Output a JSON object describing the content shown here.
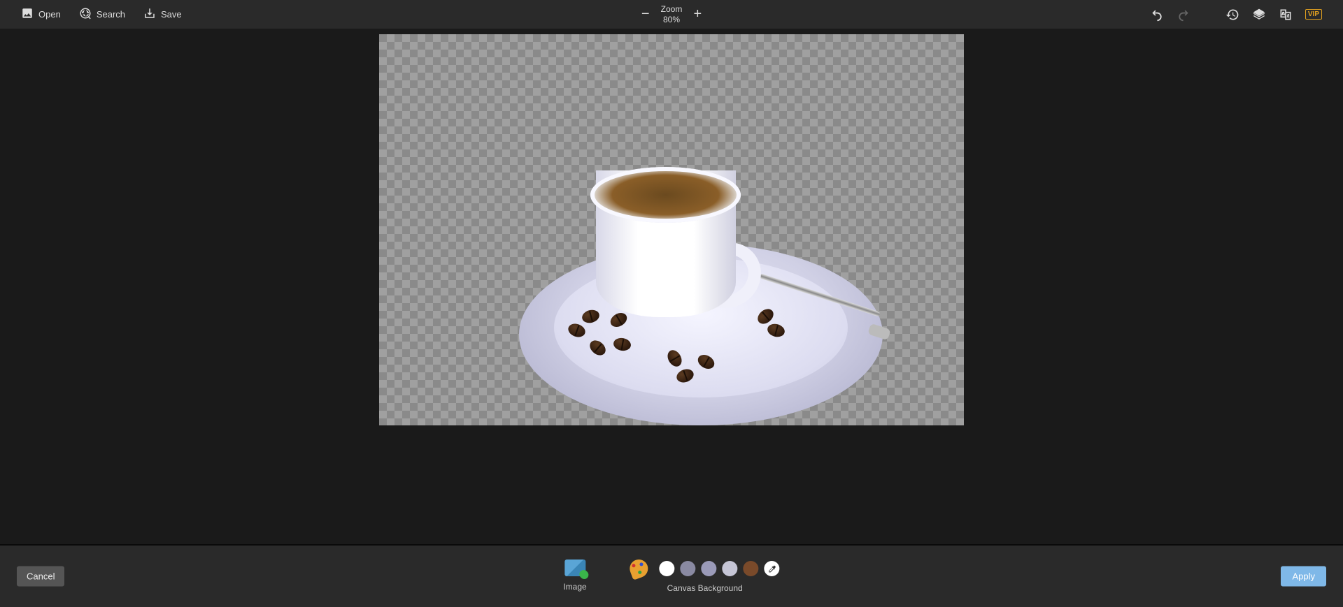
{
  "toolbar": {
    "open_label": "Open",
    "search_label": "Search",
    "save_label": "Save",
    "zoom_title": "Zoom",
    "zoom_value": "80%",
    "vip": "VIP"
  },
  "bottom": {
    "cancel": "Cancel",
    "apply": "Apply",
    "image_label": "Image",
    "bg_label": "Canvas Background",
    "swatches": [
      "#ffffff",
      "#8a8aa2",
      "#9a9ab8",
      "#c5c5d5",
      "#7a4a2a"
    ]
  }
}
